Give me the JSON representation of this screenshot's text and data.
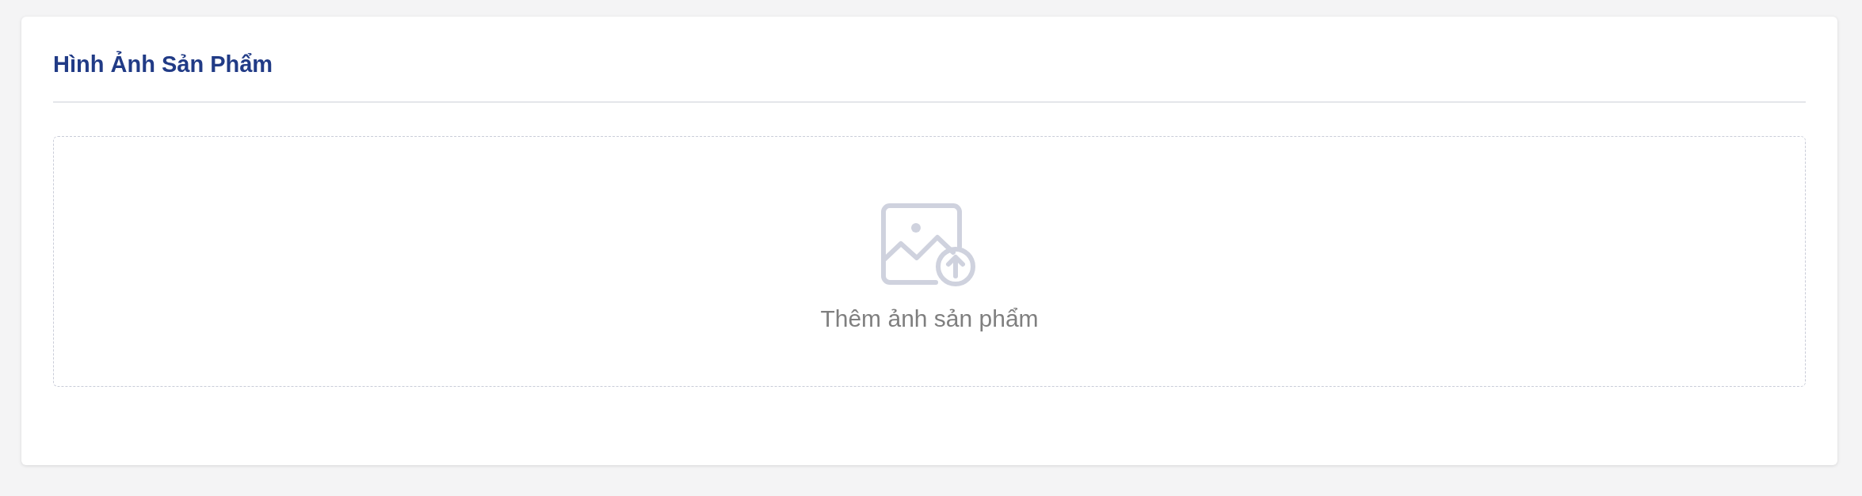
{
  "card": {
    "title": "Hình Ảnh Sản Phẩm"
  },
  "upload": {
    "label": "Thêm ảnh sản phẩm"
  }
}
